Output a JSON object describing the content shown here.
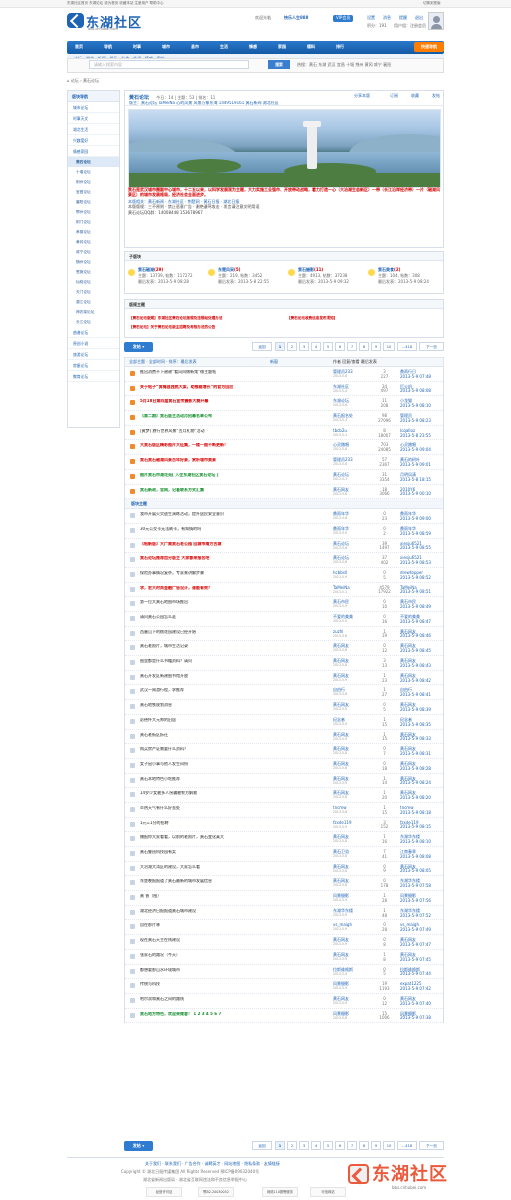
{
  "top": {
    "left": "东湖社区首页  东湖论坛  设为首页  收藏本站  注册用户  帮助中心",
    "right": "切换到宽版"
  },
  "brand": {
    "name": "东湖社区",
    "url": "bbs.cnhubei.com",
    "welcome": "欢迎光临",
    "user": "快乐人生888",
    "level": "VIP会员",
    "links": [
      "设置",
      "消息",
      "提醒",
      "退出"
    ],
    "credits": "积分：191",
    "group": "用户组：注册会员"
  },
  "nav": {
    "items": [
      "首页",
      "导航",
      "时事",
      "城市",
      "县市",
      "生活",
      "情感",
      "家园",
      "爆料",
      "排行"
    ],
    "post": "快速导航"
  },
  "subnav": "论坛  ·  湖北  ·  新闻  ·  娱乐  ·  社会  ·  生活  ·  情感  ·  图片",
  "search": {
    "placeholder": "请输入搜索内容",
    "button": "搜索",
    "hot": "热搜：黄石  东湖  武汉  宜昌  十堰  荆州  黄冈  咸宁  襄阳"
  },
  "breadcrumb": "论坛  ›  黄石论坛",
  "sidebar": {
    "title": "版块导航",
    "sections": [
      "城市论坛",
      "时事天文",
      "湖北生活",
      "兴趣爱好",
      "情感家园"
    ],
    "active": "黄石论坛",
    "cities": [
      "十堰论坛",
      "荆州论坛",
      "宜昌论坛",
      "襄阳论坛",
      "鄂州论坛",
      "荆门论坛",
      "孝感论坛",
      "黄冈论坛",
      "咸宁论坛",
      "随州论坛",
      "恩施论坛",
      "仙桃论坛",
      "天门论坛",
      "潜江论坛",
      "神农架论坛",
      "长江论坛"
    ],
    "bottom": [
      "曲谱论坛",
      "原创小说",
      "旅游论坛",
      "房屋论坛",
      "教育论坛"
    ]
  },
  "forum": {
    "title": "黄石论坛",
    "stats": "今日：14 | 主题：53 | 排名：11",
    "mods": "版主：黄石论坛  TaMeiNa  心的风景  风景万象东海  1449519161  黄石新闻  湖北社区",
    "actions": [
      "分享本版",
      "订阅",
      "收藏",
      "发帖"
    ],
    "desc_red": "黄石是武汉城市圈副中心城市，十二五以来，以科学发展观为主题，大力实施工业强市、开放带动战略，着力打造一心（大冶湖生态新区）一带（长江沿岸经济带）一片（磁湖风景区）的城市发展格局，经济社会全面进步。",
    "desc_link": "本版相关：黄石新闻 · 东湖社区 · 荆楚网 · 黄石日报 · 湖北日报",
    "desc_rules": "本版版规：三不原则 · 禁止恶意广告 · 谢绝谩骂攻击 · 发言请注意文明用语",
    "desc_contact": "黄石论坛QQ群：14008448  153678967"
  },
  "subforums": [
    {
      "name": "黄石磁湖",
      "count": "(29)",
      "meta": "主题：13739, 帖数：117272",
      "last": "最后发表：2013-5-9 08:28"
    },
    {
      "name": "东楚风采",
      "count": "(5)",
      "meta": "主题：219, 帖数：3452",
      "last": "最后发表：2013-5-8 22:55"
    },
    {
      "name": "黄石摄影",
      "count": "(11)",
      "meta": "主题：4913, 帖数：37238",
      "last": "最后发表：2013-5-9 09:32"
    },
    {
      "name": "黄石美食",
      "count": "(2)",
      "meta": "主题：104, 帖数：308",
      "last": "最后发表：2013-5-9 08:24"
    }
  ],
  "moderator": {
    "title": "版规主题",
    "lines": [
      "【黄石论坛版规】东湖社区黄石论坛版规及违规帖处理办法",
      "【黄石论坛收费信息发布须知】",
      "【黄石论坛】关于黄石论坛版主招聘及考核办法的公告"
    ]
  },
  "pager": {
    "prev": "返回",
    "pages": [
      "1",
      "2",
      "3",
      "4",
      "5",
      "6",
      "7",
      "8",
      "9",
      "10"
    ],
    "ellipsis": "...",
    "last": "418",
    "next": "下一页"
  },
  "toolbar": {
    "left": "全部主题  ·  全部时间  ·  排序：最后发表",
    "right": "作者  回复/查看  最后发表",
    "filter": "新窗"
  },
  "threads": [
    {
      "title": "推出消费不下谢谢“看风向做新策”微主题帖",
      "author": "管理员233",
      "date": "2013-5-8",
      "count": "3\n227",
      "last": "鼎雨行日\n2013-5-9 07:48",
      "type": "pin"
    },
    {
      "title": "关于帖子“黄梅县独挑大梁，助推稳增长”的官方回应",
      "author": "东湖社区",
      "date": "2013-5-4",
      "count": "34\n497",
      "last": "打火机\n2013-5-9 08:08",
      "type": "red"
    },
    {
      "title": "5月18日第四届黄石宣传摄影大赛开幕",
      "author": "东湖论坛",
      "date": "2013-5-6",
      "count": "11\n208",
      "last": "小龙猫\n2013-5-9 08:10",
      "type": "red"
    },
    {
      "title": "【第二期】黄石版主活动月招募名单公布",
      "author": "黄石报名处",
      "date": "2013-5-3",
      "count": "98\n27096",
      "last": "管理员\n2013-5-9 08:23",
      "type": "green"
    },
    {
      "title": "[黄梦] 旅行世界风景“五月礼物”活动",
      "author": "tbcb2u",
      "date": "2013-5-1",
      "count": "8\n18007",
      "last": "lcqalloz\n2013-5-8 23:55",
      "type": "normal"
    },
    {
      "title": "大黄石版区精彩图片大征集，一楼一图不断更新！",
      "author": "心灵踏唱",
      "date": "2013-5-8",
      "count": "703\n24085",
      "last": "心灵踏唱\n2013-5-9 09:04",
      "type": "red"
    },
    {
      "title": "黄石黄石磁湖风景百年好景，赏析城市美景",
      "author": "管理员233",
      "date": "2013-5-6",
      "count": "57\n2367",
      "last": "黄石的树叶\n2013-5-9 09:01",
      "type": "red"
    },
    {
      "title": "图片黄石市湖花苑[ 入住东湖社区黄石论坛 ]",
      "author": "黄石论坛",
      "date": "2013-5-1",
      "count": "31\n3354",
      "last": "月明风清\n2013-5-8 18:15",
      "type": "green"
    },
    {
      "title": "黄石新政，官网，记者联系方式汇集",
      "author": "黄石网友",
      "date": "2013-5-6",
      "count": "18\n3066",
      "last": "2010Y6\n2013-5-9 00:10",
      "type": "green"
    },
    {
      "title": "版块主题",
      "author": "",
      "date": "",
      "count": "",
      "last": "",
      "type": "sep"
    },
    {
      "title": "我市开展火灾逃生演练活动，提升居民安全意识",
      "author": "鼎雨年华",
      "date": "2013-5-8",
      "count": "0\n23",
      "last": "鼎雨年华\n2013-5-9 09:00",
      "type": "normal"
    },
    {
      "title": "30元公交卡无法刷卡，有知情的吗",
      "author": "鼎雨年华",
      "date": "2013-5-9",
      "count": "0\n2",
      "last": "鼎雨年华\n2013-5-9 08:59",
      "type": "normal"
    },
    {
      "title": "【帖新版】大广南黄石老公园 回城市南方古城",
      "author": "黄石论坛",
      "date": "2013-5-8",
      "count": "39\n1497",
      "last": "xiesju6521\n2013-5-9 08:55",
      "type": "red"
    },
    {
      "title": "黄石论坛推荐加分版主 大家都来报名吧",
      "author": "黄石论坛",
      "date": "2013-5-8",
      "count": "37\n402",
      "last": "xiesju6521\n2013-5-9 08:53",
      "type": "red"
    },
    {
      "title": "保险办事情况复杂，专家来讲解步骤",
      "author": "hcbbsll",
      "date": "2013-5-9",
      "count": "0\n5",
      "last": "drewtopper\n2013-5-9 08:52",
      "type": "normal"
    },
    {
      "title": "求，宏大时尚金融广告设计，谁能有效？",
      "author": "TaMeiNa",
      "date": "2013-5-1",
      "count": "4579\n17922",
      "last": "TaMeiNa\n2013-5-9 08:51",
      "type": "red"
    },
    {
      "title": "第一位大黄石地图市场推出",
      "author": "黄石市民",
      "date": "2013-5-9",
      "count": "0\n10",
      "last": "黄石市民\n2013-5-9 08:49",
      "type": "normal"
    },
    {
      "title": "请问黄石公园怎么走",
      "author": "不爱的美美",
      "date": "2013-5-9",
      "count": "0\n16",
      "last": "不爱的美美\n2013-5-9 08:47",
      "type": "normal"
    },
    {
      "title": "西塞山下的桃花园建设已经开始",
      "author": "zuzhl",
      "date": "2013-5-8",
      "count": "1\n19",
      "last": "黄石网友\n2013-5-9 08:46",
      "type": "normal"
    },
    {
      "title": "黄石老照片，城市生活记录",
      "author": "黄石网友",
      "date": "2013-5-8",
      "count": "0\n12",
      "last": "黄石网友\n2013-5-9 08:45",
      "type": "normal"
    },
    {
      "title": "图里都是什么书籍资料？请问",
      "author": "黄石网友",
      "date": "2013-5-8",
      "count": "3\n13",
      "last": "黄石网友\n2013-5-9 08:43",
      "type": "normal"
    },
    {
      "title": "黄石开发区新建图书馆开放",
      "author": "黄石网友",
      "date": "2013-5-9",
      "count": "1\n23",
      "last": "黄石网友\n2013-5-9 08:42",
      "type": "normal"
    },
    {
      "title": "武汉一周游行程，求推荐",
      "author": "自由行",
      "date": "2013-5-8",
      "count": "1\n27",
      "last": "自由行\n2013-5-9 08:41",
      "type": "normal"
    },
    {
      "title": "黄石地铁规划消息",
      "author": "黄石网友",
      "date": "2013-5-9",
      "count": "0\n5",
      "last": "黄石网友\n2013-5-9 08:39",
      "type": "normal"
    },
    {
      "title": "彭德怀大元帅的旧居",
      "author": "纪念者",
      "date": "2013-5-9",
      "count": "1\n15",
      "last": "纪念者\n2013-5-9 08:35",
      "type": "normal"
    },
    {
      "title": "黄石老街区拆迁",
      "author": "黄石网友",
      "date": "2013-5-9",
      "count": "1\n15",
      "last": "黄石网友\n2013-5-9 08:33",
      "type": "normal"
    },
    {
      "title": "购买房产证需要什么资料？",
      "author": "黄石网友",
      "date": "2013-5-8",
      "count": "0\n7",
      "last": "黄石网友\n2013-5-9 08:31",
      "type": "normal"
    },
    {
      "title": "女子因小事与他人发生纠纷",
      "author": "黄石网友",
      "date": "2013-5-8",
      "count": "0\n18",
      "last": "黄石网友\n2013-5-9 08:28",
      "type": "normal"
    },
    {
      "title": "黄石本地特色小吃推荐",
      "author": "黄石网友",
      "date": "2013-5-9",
      "count": "1\n14",
      "last": "黄石网友\n2013-5-9 08:24",
      "type": "normal"
    },
    {
      "title": "14岁少女被多人拐骗被警方解救",
      "author": "黄石网友",
      "date": "2013-5-8",
      "count": "1\n20",
      "last": "黄石网友\n2013-5-9 08:20",
      "type": "normal"
    },
    {
      "title": "炎热天气有什么好去处",
      "author": "tncmw",
      "date": "2013-5-8",
      "count": "1\n15",
      "last": "tncmw\n2013-5-9 08:18",
      "type": "normal"
    },
    {
      "title": "1元=1分的招聘",
      "author": "fzxde119",
      "date": "2013-5-9",
      "count": "3\n152",
      "last": "fzxde119\n2013-5-9 08:15",
      "type": "normal"
    },
    {
      "title": "播报你大家看看，以前的老照片，黄石变化真大",
      "author": "黄石网友",
      "date": "2013-5-8",
      "count": "1\n16",
      "last": "东湖华东楼\n2013-5-9 08:10",
      "type": "normal"
    },
    {
      "title": "黄石鲁班科技园有奖",
      "author": "黄石卫浴",
      "date": "2013-5-8",
      "count": "7\n41",
      "last": "江南春季\n2013-5-9 08:08",
      "type": "normal"
    },
    {
      "title": "大冶湖大湾区的建设，大家怎么看",
      "author": "黄石网友",
      "date": "2013-5-8",
      "count": "0\n9",
      "last": "黄石网友\n2013-5-9 08:05",
      "type": "normal"
    },
    {
      "title": "东楚晚报报道了黄石最新的城市发展信息",
      "author": "黄石网友",
      "date": "2013-5-8",
      "count": "0\n178",
      "last": "东湖华东楼\n2013-5-9 07:58",
      "type": "normal"
    },
    {
      "title": "黄 昏（图）",
      "author": "风景摄影",
      "date": "2013-5-9",
      "count": "1\n28",
      "last": "风景摄影\n2013-5-9 07:56",
      "type": "normal"
    },
    {
      "title": "湖北经济日报报道黄石城市建设",
      "author": "东湖华东楼",
      "date": "2013-5-9",
      "count": "1\n48",
      "last": "东湖华东楼\n2013-5-9 07:52",
      "type": "normal"
    },
    {
      "title": "自在那片林",
      "author": "vs_maigh",
      "date": "2013-5-9",
      "count": "0\n28",
      "last": "vs_maigh\n2013-5-9 07:49",
      "type": "normal"
    },
    {
      "title": "现在黄石天主在线建设",
      "author": "黄石网友",
      "date": "2013-5-9",
      "count": "0\n8",
      "last": "黄石网友\n2013-5-9 07:47",
      "type": "normal"
    },
    {
      "title": "张家石的路况（今天）",
      "author": "黄石网友",
      "date": "2013-5-9",
      "count": "1\n8",
      "last": "黄石网友\n2013-5-9 07:45",
      "type": "normal"
    },
    {
      "title": "都想要那山水环境城市",
      "author": "拉斯维格斯",
      "date": "2013-5-9",
      "count": "0\n5",
      "last": "拉斯维格斯\n2013-5-9 07:44",
      "type": "normal"
    },
    {
      "title": "传统与科技",
      "author": "风景摄影",
      "date": "2013-5-9",
      "count": "19\n1193",
      "last": "expat1225\n2013-5-9 07:42",
      "type": "normal"
    },
    {
      "title": "哈尔滨和黄石之间的路线",
      "author": "黄石网友",
      "date": "2013-5-9",
      "count": "0\n12",
      "last": "黄石网友\n2013-5-9 07:40",
      "type": "normal"
    },
    {
      "title": "黄石地方特色，欢迎来做客！ 1 2 3 4 5 6 7",
      "author": "风景摄影",
      "date": "2013-5-8",
      "count": "15\n1006",
      "last": "风景摄影\n2013-5-9 07:38",
      "type": "green"
    }
  ],
  "footer": {
    "line1": "关于我们 · 联系我们 · 广告合作 · 诚聘英才 · 网站地图 · 隐私条款 · 友情链接",
    "line2": "Copyright © 湖北日报传媒集团 All Rights Reserved 鄂ICP备09032040号",
    "line3": "湖北省新闻出版局 · 湖北省互联网违法和不良信息举报中心",
    "badges": [
      "经营许可证",
      "鄂B2-20030052",
      "网络110报警服务",
      "可信网站"
    ]
  },
  "watermark": {
    "text": "东湖社区",
    "url": "bbs.cnhubei.com"
  }
}
